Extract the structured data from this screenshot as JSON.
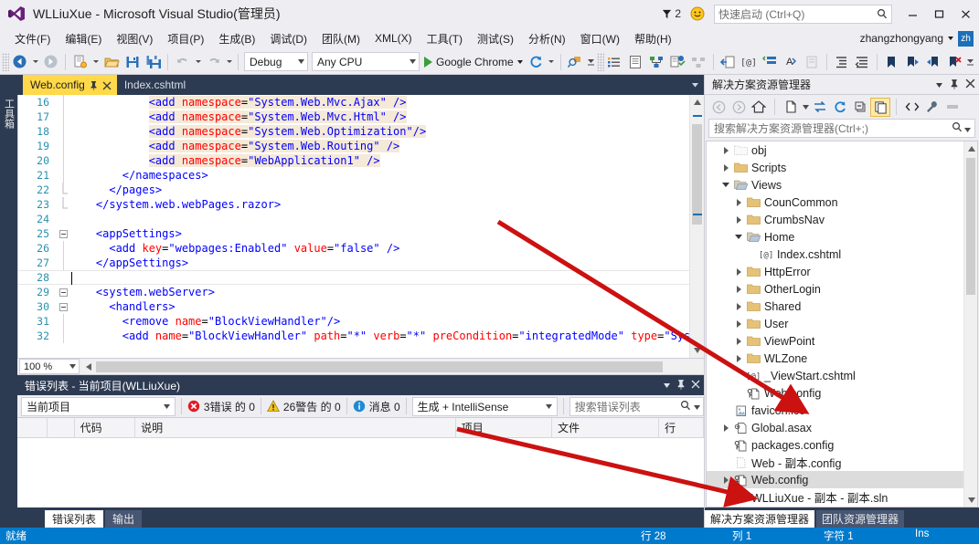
{
  "titlebar": {
    "title": "WLLiuXue - Microsoft Visual Studio(管理员)",
    "notification_count": "2",
    "quick_launch_placeholder": "快速启动 (Ctrl+Q)",
    "minimize": "minimize-icon",
    "maximize": "maximize-icon",
    "close": "close-icon"
  },
  "menubar": {
    "items": [
      {
        "label": "文件(F)"
      },
      {
        "label": "编辑(E)"
      },
      {
        "label": "视图(V)"
      },
      {
        "label": "项目(P)"
      },
      {
        "label": "生成(B)"
      },
      {
        "label": "调试(D)"
      },
      {
        "label": "团队(M)"
      },
      {
        "label": "XML(X)"
      },
      {
        "label": "工具(T)"
      },
      {
        "label": "测试(S)"
      },
      {
        "label": "分析(N)"
      },
      {
        "label": "窗口(W)"
      },
      {
        "label": "帮助(H)"
      }
    ],
    "user": "zhangzhongyang"
  },
  "toolbar": {
    "configuration": "Debug",
    "platform": "Any CPU",
    "run_target": "Google Chrome",
    "icons": [
      "navigate-back-icon",
      "navigate-forward-icon",
      "new-project-icon",
      "open-file-icon",
      "save-icon",
      "save-all-icon",
      "undo-icon",
      "redo-icon",
      "start-debug-icon",
      "refresh-icon",
      "find-icon",
      "bullet-list-icon",
      "properties-window-icon",
      "solution-explorer-icon",
      "class-view-icon",
      "object-browser-icon",
      "indent-icon",
      "comment-icon",
      "uncomment-icon",
      "format-icon",
      "increase-indent-icon",
      "decrease-indent-icon",
      "bookmark-icon",
      "next-bookmark-icon",
      "previous-bookmark-icon",
      "clear-bookmarks-icon"
    ]
  },
  "toolbox": {
    "label": "工具箱"
  },
  "editor": {
    "tabs": [
      {
        "label": "Web.config",
        "active": true,
        "pinned": true,
        "closeable": true
      },
      {
        "label": "Index.cshtml",
        "active": false,
        "pinned": false,
        "closeable": false
      }
    ],
    "zoom": "100 %",
    "lines": [
      {
        "num": "16",
        "fold": "",
        "indent": true,
        "segments": [
          {
            "t": "            ",
            "c": "k-plain"
          },
          {
            "t": "<add ",
            "c": "k-tag hl"
          },
          {
            "t": "namespace",
            "c": "k-attr hl"
          },
          {
            "t": "=",
            "c": "k-plain hl"
          },
          {
            "t": "\"System.Web.Mvc.Ajax\"",
            "c": "k-val hl"
          },
          {
            "t": " />",
            "c": "k-tag hl"
          }
        ]
      },
      {
        "num": "17",
        "fold": "",
        "indent": true,
        "segments": [
          {
            "t": "            ",
            "c": "k-plain"
          },
          {
            "t": "<add ",
            "c": "k-tag hl"
          },
          {
            "t": "namespace",
            "c": "k-attr hl"
          },
          {
            "t": "=",
            "c": "k-plain hl"
          },
          {
            "t": "\"System.Web.Mvc.Html\"",
            "c": "k-val hl"
          },
          {
            "t": " />",
            "c": "k-tag hl"
          }
        ]
      },
      {
        "num": "18",
        "fold": "",
        "indent": true,
        "segments": [
          {
            "t": "            ",
            "c": "k-plain"
          },
          {
            "t": "<add ",
            "c": "k-tag hl"
          },
          {
            "t": "namespace",
            "c": "k-attr hl"
          },
          {
            "t": "=",
            "c": "k-plain hl"
          },
          {
            "t": "\"System.Web.Optimization\"",
            "c": "k-val hl"
          },
          {
            "t": "/>",
            "c": "k-tag hl"
          }
        ]
      },
      {
        "num": "19",
        "fold": "",
        "indent": true,
        "segments": [
          {
            "t": "            ",
            "c": "k-plain"
          },
          {
            "t": "<add ",
            "c": "k-tag hl"
          },
          {
            "t": "namespace",
            "c": "k-attr hl"
          },
          {
            "t": "=",
            "c": "k-plain hl"
          },
          {
            "t": "\"System.Web.Routing\"",
            "c": "k-val hl"
          },
          {
            "t": " />",
            "c": "k-tag hl"
          }
        ]
      },
      {
        "num": "20",
        "fold": "",
        "indent": true,
        "segments": [
          {
            "t": "            ",
            "c": "k-plain"
          },
          {
            "t": "<add ",
            "c": "k-tag hl"
          },
          {
            "t": "namespace",
            "c": "k-attr hl"
          },
          {
            "t": "=",
            "c": "k-plain hl"
          },
          {
            "t": "\"WebApplication1\"",
            "c": "k-val hl"
          },
          {
            "t": " />",
            "c": "k-tag hl"
          }
        ]
      },
      {
        "num": "21",
        "fold": "",
        "indent": true,
        "segments": [
          {
            "t": "        ",
            "c": "k-plain"
          },
          {
            "t": "</namespaces>",
            "c": "k-tag"
          }
        ]
      },
      {
        "num": "22",
        "fold": "end",
        "indent": true,
        "segments": [
          {
            "t": "      ",
            "c": "k-plain"
          },
          {
            "t": "</pages>",
            "c": "k-tag"
          }
        ]
      },
      {
        "num": "23",
        "fold": "end",
        "indent": false,
        "segments": [
          {
            "t": "    ",
            "c": "k-plain"
          },
          {
            "t": "</system.web.webPages.razor>",
            "c": "k-tag"
          }
        ]
      },
      {
        "num": "24",
        "fold": "",
        "indent": false,
        "segments": []
      },
      {
        "num": "25",
        "fold": "box",
        "indent": false,
        "segments": [
          {
            "t": "    ",
            "c": "k-plain"
          },
          {
            "t": "<appSettings>",
            "c": "k-tag"
          }
        ]
      },
      {
        "num": "26",
        "fold": "",
        "indent": true,
        "segments": [
          {
            "t": "      ",
            "c": "k-plain"
          },
          {
            "t": "<add ",
            "c": "k-tag"
          },
          {
            "t": "key",
            "c": "k-attr"
          },
          {
            "t": "=",
            "c": "k-plain"
          },
          {
            "t": "\"webpages:Enabled\"",
            "c": "k-val"
          },
          {
            "t": " ",
            "c": "k-plain"
          },
          {
            "t": "value",
            "c": "k-attr"
          },
          {
            "t": "=",
            "c": "k-plain"
          },
          {
            "t": "\"false\"",
            "c": "k-val"
          },
          {
            "t": " />",
            "c": "k-tag"
          }
        ]
      },
      {
        "num": "27",
        "fold": "",
        "indent": true,
        "segments": [
          {
            "t": "    ",
            "c": "k-plain"
          },
          {
            "t": "</appSettings>",
            "c": "k-tag"
          }
        ]
      },
      {
        "num": "28",
        "fold": "",
        "indent": false,
        "segments": [],
        "current": true
      },
      {
        "num": "29",
        "fold": "box",
        "indent": false,
        "segments": [
          {
            "t": "    ",
            "c": "k-plain"
          },
          {
            "t": "<system.webServer>",
            "c": "k-tag"
          }
        ]
      },
      {
        "num": "30",
        "fold": "box",
        "indent": true,
        "segments": [
          {
            "t": "      ",
            "c": "k-plain"
          },
          {
            "t": "<handlers>",
            "c": "k-tag"
          }
        ]
      },
      {
        "num": "31",
        "fold": "",
        "indent": true,
        "segments": [
          {
            "t": "        ",
            "c": "k-plain"
          },
          {
            "t": "<remove ",
            "c": "k-tag"
          },
          {
            "t": "name",
            "c": "k-attr"
          },
          {
            "t": "=",
            "c": "k-plain"
          },
          {
            "t": "\"BlockViewHandler\"",
            "c": "k-val"
          },
          {
            "t": "/>",
            "c": "k-tag"
          }
        ]
      },
      {
        "num": "32",
        "fold": "",
        "indent": true,
        "segments": [
          {
            "t": "        ",
            "c": "k-plain"
          },
          {
            "t": "<add ",
            "c": "k-tag"
          },
          {
            "t": "name",
            "c": "k-attr"
          },
          {
            "t": "=",
            "c": "k-plain"
          },
          {
            "t": "\"BlockViewHandler\"",
            "c": "k-val"
          },
          {
            "t": " ",
            "c": "k-plain"
          },
          {
            "t": "path",
            "c": "k-attr"
          },
          {
            "t": "=",
            "c": "k-plain"
          },
          {
            "t": "\"*\"",
            "c": "k-val"
          },
          {
            "t": " ",
            "c": "k-plain"
          },
          {
            "t": "verb",
            "c": "k-attr"
          },
          {
            "t": "=",
            "c": "k-plain"
          },
          {
            "t": "\"*\"",
            "c": "k-val"
          },
          {
            "t": " ",
            "c": "k-plain"
          },
          {
            "t": "preCondition",
            "c": "k-attr"
          },
          {
            "t": "=",
            "c": "k-plain"
          },
          {
            "t": "\"integratedMode\"",
            "c": "k-val"
          },
          {
            "t": " ",
            "c": "k-plain"
          },
          {
            "t": "type",
            "c": "k-attr"
          },
          {
            "t": "=",
            "c": "k-plain"
          },
          {
            "t": "\"Sys",
            "c": "k-val"
          }
        ]
      }
    ]
  },
  "errorlist": {
    "title": "错误列表 - 当前项目(WLLiuXue)",
    "scope": "当前项目",
    "errors": "3错误 的 0",
    "warnings": "26警告 的 0",
    "messages": "消息 0",
    "build_filter": "生成 + IntelliSense",
    "search_placeholder": "搜索错误列表",
    "columns": [
      {
        "label": ""
      },
      {
        "label": ""
      },
      {
        "label": "代码"
      },
      {
        "label": "说明"
      },
      {
        "label": "项目"
      },
      {
        "label": "文件"
      },
      {
        "label": "行"
      }
    ],
    "rows": [],
    "tabs": [
      {
        "label": "错误列表",
        "active": true
      },
      {
        "label": "输出",
        "active": false
      }
    ]
  },
  "solution": {
    "title": "解决方案资源管理器",
    "search_placeholder": "搜索解决方案资源管理器(Ctrl+;)",
    "toolbar_icons": [
      "back-icon",
      "forward-icon",
      "home-icon",
      "new-file-icon",
      "sync-icon",
      "refresh-icon",
      "collapse-all-icon",
      "show-all-files-icon",
      "view-code-icon",
      "properties-icon",
      "preview-icon"
    ],
    "tree": [
      {
        "label": "obj",
        "indent": 1,
        "expander": "right",
        "icon": "folder-dim-icon",
        "selected": false
      },
      {
        "label": "Scripts",
        "indent": 1,
        "expander": "right",
        "icon": "folder-icon",
        "selected": false
      },
      {
        "label": "Views",
        "indent": 1,
        "expander": "down",
        "icon": "folder-open-icon",
        "selected": false
      },
      {
        "label": "CounCommon",
        "indent": 2,
        "expander": "right",
        "icon": "folder-icon",
        "selected": false
      },
      {
        "label": "CrumbsNav",
        "indent": 2,
        "expander": "right",
        "icon": "folder-icon",
        "selected": false
      },
      {
        "label": "Home",
        "indent": 2,
        "expander": "down",
        "icon": "folder-open-icon",
        "selected": false
      },
      {
        "label": "Index.cshtml",
        "indent": 3,
        "expander": "none",
        "icon": "razor-file-icon",
        "selected": false
      },
      {
        "label": "HttpError",
        "indent": 2,
        "expander": "right",
        "icon": "folder-icon",
        "selected": false
      },
      {
        "label": "OtherLogin",
        "indent": 2,
        "expander": "right",
        "icon": "folder-icon",
        "selected": false
      },
      {
        "label": "Shared",
        "indent": 2,
        "expander": "right",
        "icon": "folder-icon",
        "selected": false
      },
      {
        "label": "User",
        "indent": 2,
        "expander": "right",
        "icon": "folder-icon",
        "selected": false
      },
      {
        "label": "ViewPoint",
        "indent": 2,
        "expander": "right",
        "icon": "folder-icon",
        "selected": false
      },
      {
        "label": "WLZone",
        "indent": 2,
        "expander": "right",
        "icon": "folder-icon",
        "selected": false
      },
      {
        "label": "_ViewStart.cshtml",
        "indent": 2,
        "expander": "none",
        "icon": "razor-file-icon",
        "selected": false
      },
      {
        "label": "Web.config",
        "indent": 2,
        "expander": "none",
        "icon": "config-file-icon",
        "selected": false
      },
      {
        "label": "favicon.ico",
        "indent": 1,
        "expander": "none",
        "icon": "image-file-icon",
        "selected": false
      },
      {
        "label": "Global.asax",
        "indent": 1,
        "expander": "right",
        "icon": "asax-file-icon",
        "selected": false
      },
      {
        "label": "packages.config",
        "indent": 1,
        "expander": "none",
        "icon": "config-file-icon",
        "selected": false
      },
      {
        "label": "Web - 副本.config",
        "indent": 1,
        "expander": "none",
        "icon": "plain-file-icon",
        "selected": false
      },
      {
        "label": "Web.config",
        "indent": 1,
        "expander": "right",
        "icon": "config-file-icon",
        "selected": true
      },
      {
        "label": "WLLiuXue - 副本 - 副本.sln",
        "indent": 1,
        "expander": "none",
        "icon": "plain-file-icon",
        "selected": false
      }
    ],
    "tabs": [
      {
        "label": "解决方案资源管理器",
        "active": true
      },
      {
        "label": "团队资源管理器",
        "active": false
      }
    ]
  },
  "statusbar": {
    "state": "就绪",
    "line": "行 28",
    "col": "列 1",
    "char": "字符 1",
    "insert": "Ins"
  },
  "colors": {
    "accent": "#007acc",
    "chrome": "#2d3b52",
    "tab_active": "#ffd94a",
    "annotation_arrow": "#cc1111"
  }
}
